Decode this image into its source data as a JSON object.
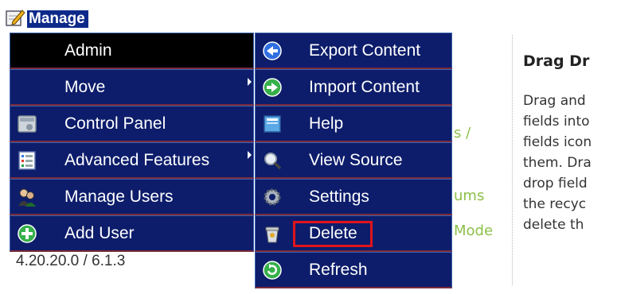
{
  "header": {
    "title": "Manage"
  },
  "main_menu": {
    "items": [
      {
        "label": "Admin",
        "icon": "none",
        "active": true
      },
      {
        "label": "Move",
        "icon": "none",
        "has_submenu": true
      },
      {
        "label": "Control Panel",
        "icon": "control-panel-icon"
      },
      {
        "label": "Advanced Features",
        "icon": "list-icon",
        "has_submenu": true
      },
      {
        "label": "Manage Users",
        "icon": "users-icon"
      },
      {
        "label": "Add User",
        "icon": "add-icon"
      }
    ]
  },
  "submenu": {
    "items": [
      {
        "label": "Export Content",
        "icon": "export-icon"
      },
      {
        "label": "Import Content",
        "icon": "import-icon"
      },
      {
        "label": "Help",
        "icon": "help-icon"
      },
      {
        "label": "View Source",
        "icon": "magnifier-icon"
      },
      {
        "label": "Settings",
        "icon": "gear-icon"
      },
      {
        "label": "Delete",
        "icon": "trash-icon",
        "highlighted": true
      },
      {
        "label": "Refresh",
        "icon": "refresh-icon"
      }
    ]
  },
  "background": {
    "partial_links": [
      "s /",
      "ums",
      "Mode"
    ],
    "version": "4.20.20.0 / 6.1.3",
    "right_panel": {
      "title": "Drag Dr",
      "lines": [
        "Drag and",
        "fields into",
        "fields icon",
        "them. Dra",
        "drop field",
        "the recyc",
        "delete th"
      ]
    }
  },
  "colors": {
    "menu_bg": "#0d1d6b",
    "header_bg": "#0d2a8a",
    "active_bg": "#000000",
    "highlight": "#e0141c",
    "link_green": "#8dc04a"
  }
}
